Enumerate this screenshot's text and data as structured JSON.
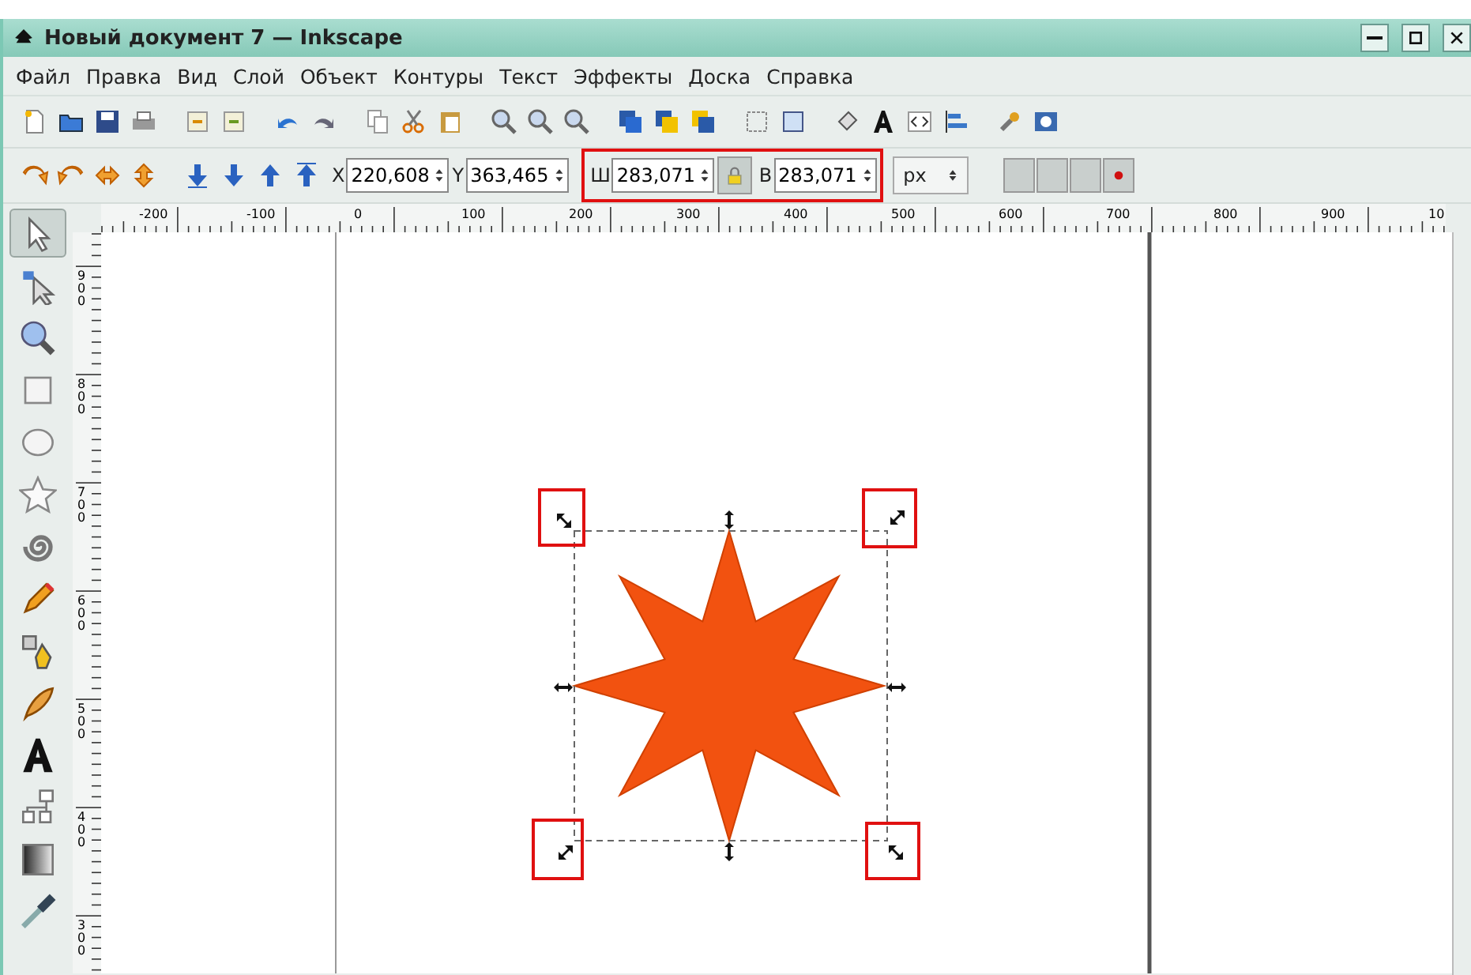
{
  "window": {
    "title": "Новый документ 7 — Inkscape"
  },
  "menu": [
    "Файл",
    "Правка",
    "Вид",
    "Слой",
    "Объект",
    "Контуры",
    "Текст",
    "Эффекты",
    "Доска",
    "Справка"
  ],
  "tools": [
    {
      "selected": true
    },
    {
      "selected": false
    },
    {
      "selected": false
    },
    {
      "selected": false
    },
    {
      "selected": false
    },
    {
      "selected": false
    },
    {
      "selected": false
    },
    {
      "selected": false
    },
    {
      "selected": false
    },
    {
      "selected": false
    },
    {
      "selected": false
    },
    {
      "selected": false
    },
    {
      "selected": false
    },
    {
      "selected": false
    }
  ],
  "tool_controls": {
    "x": {
      "label": "X",
      "value": "220,608"
    },
    "y": {
      "label": "Y",
      "value": "363,465"
    },
    "w": {
      "label": "Ш",
      "value": "283,071"
    },
    "h": {
      "label": "В",
      "value": "283,071"
    },
    "lock_on": true,
    "unit": "px"
  },
  "rulers": {
    "horizontal": [
      "-200",
      "-100",
      "0",
      "100",
      "200",
      "300",
      "400",
      "500",
      "600",
      "700",
      "800",
      "900",
      "10"
    ],
    "vertical": [
      "900",
      "800",
      "700",
      "600",
      "500",
      "400",
      "300"
    ]
  }
}
